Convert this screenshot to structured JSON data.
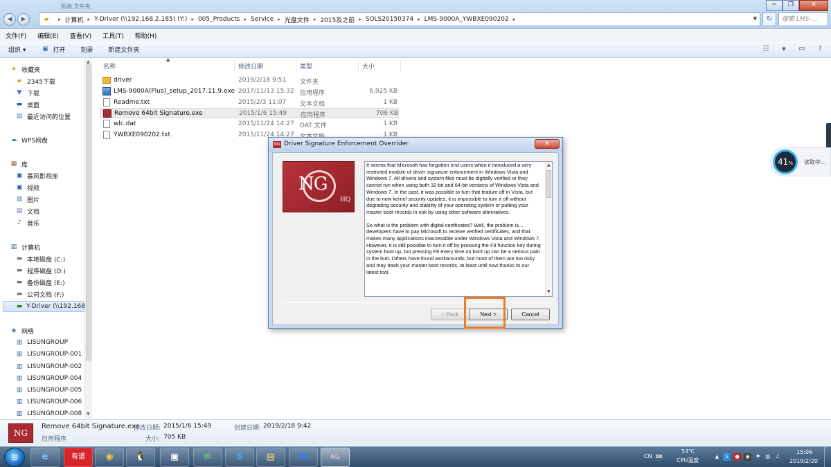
{
  "window": {
    "background_tab": "新建 文件夹",
    "breadcrumbs": [
      "计算机",
      "Y-Driver (\\\\192.168.2.185) (Y:)",
      "005_Products",
      "Service",
      "光盘文件",
      "2015及之前",
      "SOLS20150374",
      "LMS-9000A_YWBXE090202"
    ],
    "search_placeholder": "搜索 LMS-...",
    "buttons": {
      "minimize": "─",
      "maximize": "❐",
      "close": "✕"
    }
  },
  "menu": [
    "文件(F)",
    "编辑(E)",
    "查看(V)",
    "工具(T)",
    "帮助(H)"
  ],
  "toolbar": {
    "organize": "组织 ▾",
    "open": "打开",
    "burn": "刻录",
    "new_folder": "新建文件夹"
  },
  "nav": {
    "favorites": "收藏夹",
    "fav_items": [
      "2345下载",
      "下载",
      "桌面",
      "最近访问的位置"
    ],
    "wps": "WPS网盘",
    "libraries": "库",
    "lib_items": [
      "暴风影视库",
      "视频",
      "图片",
      "文档",
      "音乐"
    ],
    "computer": "计算机",
    "drives": [
      "本地磁盘 (C:)",
      "程序磁盘 (D:)",
      "备份磁盘 (E:)",
      "公司文档 (F:)",
      "Y-Driver (\\\\192.168"
    ],
    "network": "网络",
    "net_items": [
      "LISUNGROUP",
      "LISUNGROUP-001",
      "LISUNGROUP-002",
      "LISUNGROUP-004",
      "LISUNGROUP-005",
      "LISUNGROUP-006",
      "LISUNGROUP-008"
    ]
  },
  "columns": {
    "name": "名称",
    "date": "修改日期",
    "type": "类型",
    "size": "大小"
  },
  "files": [
    {
      "name": "driver",
      "date": "2019/2/18 9:51",
      "type": "文件夹",
      "size": "",
      "icon": "folder-icon"
    },
    {
      "name": "LMS-9000A(Plus)_setup_2017.11.9.exe",
      "date": "2017/11/13 15:32",
      "type": "应用程序",
      "size": "6,925 KB",
      "icon": "exe-icon"
    },
    {
      "name": "Readme.txt",
      "date": "2015/2/3 11:07",
      "type": "文本文档",
      "size": "1 KB",
      "icon": "text-file-icon"
    },
    {
      "name": "Remove 64bit Signature.exe",
      "date": "2015/1/6 15:49",
      "type": "应用程序",
      "size": "706 KB",
      "icon": "ng-app-icon"
    },
    {
      "name": "wlc.dat",
      "date": "2015/11/24 14:27",
      "type": "DAT 文件",
      "size": "1 KB",
      "icon": "dat-file-icon"
    },
    {
      "name": "YWBXE090202.txt",
      "date": "2015/11/24 14:27",
      "type": "文本文档",
      "size": "1 KB",
      "icon": "text-file-icon"
    }
  ],
  "dialog": {
    "title": "Driver Signature Enforcement Overrider",
    "close": "✕",
    "logo_text": "NG",
    "logo_sub": "HQ",
    "paragraph1": "It seems that Microsoft has forgotten end users when it introduced a very restricted module of driver signature enforcement in Windows Vista and Windows 7. All drivers and system files must be digitally verified or they cannot run when using both 32-bit and 64-bit versions of Windows Vista and Windows 7. In the past, it was possible to turn that feature off in Vista, but due to new kernel security updates, it is impossible to turn it off without degrading security and stability of your operating system or putting your master boot records in risk by using other software alternatives.",
    "paragraph2": "So what is the problem with digital certificates? Well, the problem is... developers have to pay Microsoft to receive verified certificates, and that makes many applications inaccessible under Windows Vista and Windows 7. However, it is still possible to turn it off by pressing the F8 function key during system boot up, but pressing F8 every time on boot up can be a serious pain in the butt. Others have found workarounds, but most of them are too risky and may trash your master boot records, at least until now thanks to our latest tool.",
    "back": "< Back",
    "next": "Next >",
    "cancel": "Cancel",
    "highlight_color": "#f07a24"
  },
  "gauge": {
    "value": "41",
    "unit": "%",
    "label": "读取中..."
  },
  "details": {
    "logo_text": "NG",
    "filename": "Remove 64bit Signature.exe",
    "type": "应用程序",
    "modified_label": "修改日期:",
    "modified": "2015/1/6 15:49",
    "created_label": "创建日期:",
    "created": "2019/2/18 9:42",
    "size_label": "大小:",
    "size": "705 KB"
  },
  "taskbar": {
    "apps": [
      "e",
      "有道",
      "◉",
      "🐧",
      "▣",
      "✉",
      "S",
      "▤",
      "W",
      "NG"
    ],
    "lang": "CN",
    "temp": "53℃",
    "temp_label": "CPU温度",
    "time": "15:06",
    "date": "2019/2/20"
  }
}
